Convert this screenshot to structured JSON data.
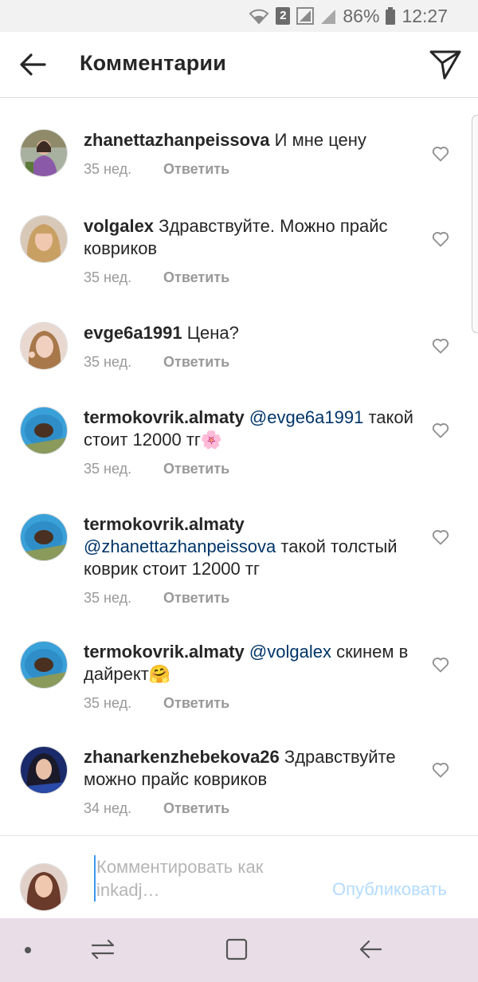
{
  "status_bar": {
    "sim_badge": "2",
    "battery": "86%",
    "time": "12:27"
  },
  "header": {
    "title": "Комментарии"
  },
  "comments": [
    {
      "username": "zhanettazhanpeissova",
      "mention": "",
      "text": "И мне цену",
      "time": "35 нед.",
      "reply_label": "Ответить"
    },
    {
      "username": "volgalex",
      "mention": "",
      "text": "Здравствуйте. Можно прайс ковриков",
      "time": "35 нед.",
      "reply_label": "Ответить"
    },
    {
      "username": "evge6a1991",
      "mention": "",
      "text": "Цена?",
      "time": "35 нед.",
      "reply_label": "Ответить"
    },
    {
      "username": "termokovrik.almaty",
      "mention": "@evge6a1991",
      "text": "такой стоит 12000 тг🌸",
      "time": "35 нед.",
      "reply_label": "Ответить"
    },
    {
      "username": "termokovrik.almaty",
      "mention": "@zhanettazhanpeissova",
      "text": "такой толстый коврик стоит 12000 тг",
      "time": "35 нед.",
      "reply_label": "Ответить"
    },
    {
      "username": "termokovrik.almaty",
      "mention": "@volgalex",
      "text": "скинем в дайрект🤗",
      "time": "35 нед.",
      "reply_label": "Ответить"
    },
    {
      "username": "zhanarkenzhebekova26",
      "mention": "",
      "text": "Здравствуйте можно прайс ковриков",
      "time": "34 нед.",
      "reply_label": "Ответить"
    }
  ],
  "composer": {
    "placeholder": "Комментировать как inkadj…",
    "publish_label": "Опубликовать"
  },
  "colors": {
    "mention": "#003569",
    "publish_disabled": "#b3dbff",
    "meta": "#999999",
    "navbar": "#e9dde7"
  }
}
